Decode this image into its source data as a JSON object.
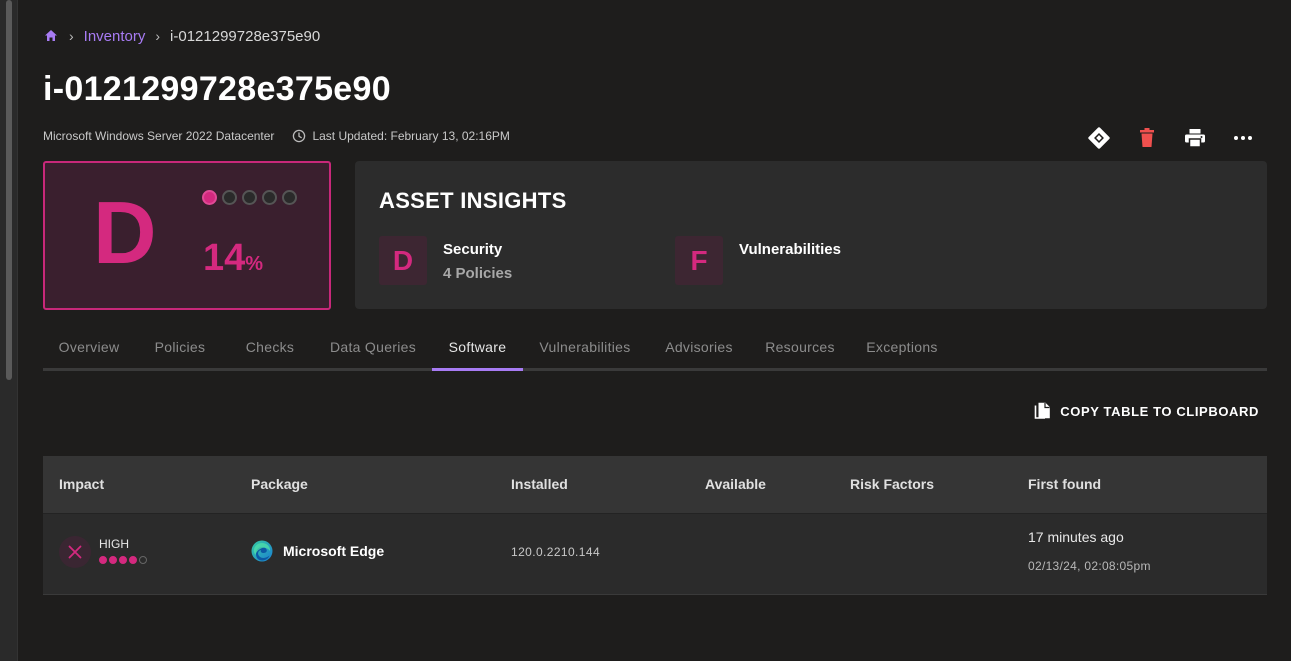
{
  "breadcrumb": {
    "home_icon": "home-icon",
    "items": [
      "Inventory",
      "i-0121299728e375e90"
    ]
  },
  "asset": {
    "title": "i-0121299728e375e90",
    "os": "Microsoft Windows Server 2022 Datacenter",
    "last_updated": "Last Updated: February 13, 02:16PM"
  },
  "actions": {
    "icons": [
      "jira-icon",
      "trash-icon",
      "print-icon",
      "more-icon"
    ]
  },
  "score": {
    "grade": "D",
    "percent": "14",
    "percent_symbol": "%",
    "dots_filled": 1,
    "dots_total": 5,
    "accent": "#d4297f"
  },
  "insights": {
    "title": "ASSET INSIGHTS",
    "items": [
      {
        "grade": "D",
        "name": "Security",
        "sub": "4 Policies"
      },
      {
        "grade": "F",
        "name": "Vulnerabilities",
        "sub": ""
      }
    ]
  },
  "tabs": [
    "Overview",
    "Policies",
    "Checks",
    "Data Queries",
    "Software",
    "Vulnerabilities",
    "Advisories",
    "Resources",
    "Exceptions"
  ],
  "active_tab": "Software",
  "copy_button": "COPY TABLE TO CLIPBOARD",
  "table": {
    "columns": [
      "Impact",
      "Package",
      "Installed",
      "Available",
      "Risk Factors",
      "First found"
    ],
    "rows": [
      {
        "impact": "HIGH",
        "impact_level": 4,
        "impact_max": 5,
        "package": "Microsoft Edge",
        "package_icon": "edge-icon",
        "installed": "120.0.2210.144",
        "available": "",
        "risk_factors": "",
        "first_found_relative": "17 minutes ago",
        "first_found_absolute": "02/13/24, 02:08:05pm"
      }
    ]
  },
  "colors": {
    "background": "#1e1d1c",
    "link": "#a77bf3",
    "grade_d": "#d4297f",
    "danger": "#f0504e"
  }
}
